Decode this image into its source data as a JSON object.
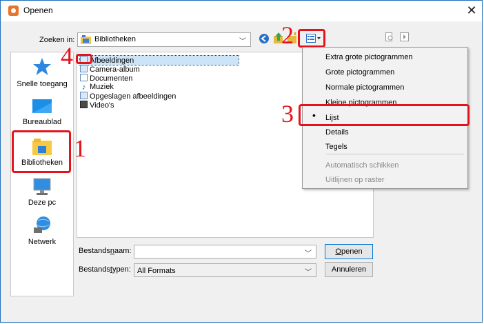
{
  "window": {
    "title": "Openen",
    "close_glyph": "✕"
  },
  "toolbar": {
    "look_in_label": "Zoeken in:",
    "look_in_value": "Bibliotheken"
  },
  "places": [
    {
      "label": "Snelle toegang",
      "icon": "star-icon"
    },
    {
      "label": "Bureaublad",
      "icon": "desktop-icon"
    },
    {
      "label": "Bibliotheken",
      "icon": "libraries-icon"
    },
    {
      "label": "Deze pc",
      "icon": "computer-icon"
    },
    {
      "label": "Netwerk",
      "icon": "network-icon"
    }
  ],
  "files": [
    {
      "name": "Afbeeldingen",
      "icon": "pictures-icon"
    },
    {
      "name": "Camera-album",
      "icon": "pictures-icon"
    },
    {
      "name": "Documenten",
      "icon": "documents-icon"
    },
    {
      "name": "Muziek",
      "icon": "music-icon"
    },
    {
      "name": "Opgeslagen afbeeldingen",
      "icon": "pictures-icon"
    },
    {
      "name": "Video's",
      "icon": "videos-icon"
    }
  ],
  "view_menu": {
    "items": [
      {
        "label": "Extra grote pictogrammen",
        "enabled": true
      },
      {
        "label": "Grote pictogrammen",
        "enabled": true
      },
      {
        "label": "Normale pictogrammen",
        "enabled": true
      },
      {
        "label": "Kleine pictogrammen",
        "enabled": true
      },
      {
        "label": "Lijst",
        "enabled": true,
        "checked": true
      },
      {
        "label": "Details",
        "enabled": true
      },
      {
        "label": "Tegels",
        "enabled": true
      },
      {
        "label": "Automatisch schikken",
        "enabled": false
      },
      {
        "label": "Uitlijnen op raster",
        "enabled": false
      }
    ],
    "check_glyph": "•"
  },
  "bottom": {
    "filename_label": "Bestandsnaam:",
    "filename_value": "",
    "filetype_label": "Bestandstypen:",
    "filetype_value": "All Formats",
    "open_button": "Openen",
    "cancel_button": "Annuleren"
  },
  "annotations": [
    "1",
    "2",
    "3",
    "4"
  ],
  "colors": {
    "annotation_red": "#e4131b",
    "selection": "#cce4f7",
    "accent": "#0078d7"
  }
}
